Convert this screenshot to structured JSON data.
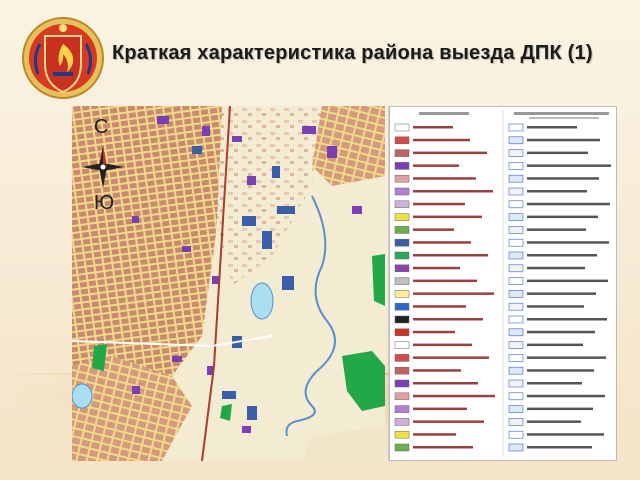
{
  "slide": {
    "title": "Краткая характеристика района выезда ДПК (1)"
  },
  "compass": {
    "north": "С",
    "south": "Ю"
  },
  "emblem": {
    "icon": "fire-service-emblem-icon",
    "colors": {
      "shield": "#c8311f",
      "ring": "#e8c05a",
      "accent": "#1a3a8a"
    }
  },
  "map": {
    "colors": {
      "residential": "#c98a6e",
      "roads": "#f0d98a",
      "industrial": "#3a5faa",
      "purple_buildings": "#7a3fb5",
      "water": "#a9dff0",
      "river": "#5a8fd0",
      "forest": "#22a847",
      "background": "#f3ecd2"
    }
  },
  "legend": {
    "colors": {
      "frame": "#888888",
      "swatches": [
        "#ffffff",
        "#d84a4a",
        "#c06060",
        "#7a3fb5",
        "#e0a0a0",
        "#b27fd0",
        "#d0b0d8",
        "#f0e040",
        "#6ab04c",
        "#3a5faa",
        "#2aa860",
        "#8844aa",
        "#c0c0c0",
        "#ffee99",
        "#3366cc",
        "#222222",
        "#cc3322"
      ]
    }
  }
}
